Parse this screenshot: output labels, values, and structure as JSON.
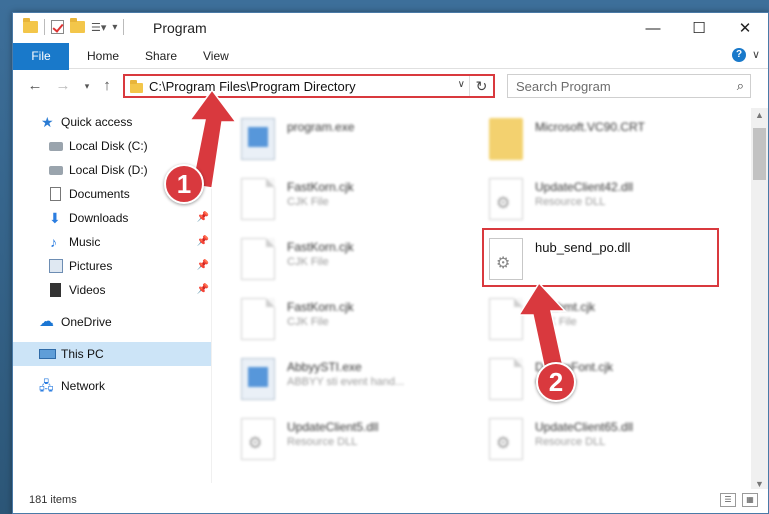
{
  "window": {
    "title": "Program"
  },
  "window_controls": {
    "minimize": "—",
    "maximize": "☐",
    "close": "✕"
  },
  "ribbon": {
    "tabs": [
      "File",
      "Home",
      "Share",
      "View"
    ]
  },
  "address_bar": {
    "path": "C:\\Program Files\\Program Directory"
  },
  "search": {
    "placeholder": "Search Program"
  },
  "nav_pane": {
    "items": [
      {
        "label": "Quick access",
        "icon": "star-icon"
      },
      {
        "label": "Local Disk (C:)",
        "icon": "drive-icon"
      },
      {
        "label": "Local Disk (D:)",
        "icon": "drive-icon"
      },
      {
        "label": "Documents",
        "icon": "documents-icon"
      },
      {
        "label": "Downloads",
        "icon": "download-icon"
      },
      {
        "label": "Music",
        "icon": "music-icon"
      },
      {
        "label": "Pictures",
        "icon": "pictures-icon"
      },
      {
        "label": "Videos",
        "icon": "videos-icon"
      },
      {
        "label": "OneDrive",
        "icon": "onedrive-icon"
      },
      {
        "label": "This PC",
        "icon": "this-pc-icon"
      },
      {
        "label": "Network",
        "icon": "network-icon"
      }
    ]
  },
  "files": [
    {
      "name": "program.exe",
      "type": ""
    },
    {
      "name": "Microsoft.VC90.CRT",
      "type": ""
    },
    {
      "name": "FastKorn.cjk",
      "type": "CJK File"
    },
    {
      "name": "UpdateClient42.dll",
      "type": "Resource DLL"
    },
    {
      "name": "FastKorn.cjk",
      "type": "CJK File"
    },
    {
      "name": "hub_send_po.dll",
      "type": ""
    },
    {
      "name": "FastKorn.cjk",
      "type": "CJK File"
    },
    {
      "name": "Dutthmt.cjk",
      "type": "CJK File"
    },
    {
      "name": "AbbyySTI.exe",
      "type": "ABBYY sti event hand..."
    },
    {
      "name": "DreamFont.cjk",
      "type": "CJK File"
    },
    {
      "name": "UpdateClient5.dll",
      "type": "Resource DLL"
    },
    {
      "name": "UpdateClient65.dll",
      "type": "Resource DLL"
    }
  ],
  "status_bar": {
    "item_count": "181 items"
  },
  "callouts": {
    "step1": "1",
    "step2": "2"
  },
  "colors": {
    "accent": "#1979ca",
    "highlight": "#d9393e",
    "selection": "#cce4f7"
  }
}
